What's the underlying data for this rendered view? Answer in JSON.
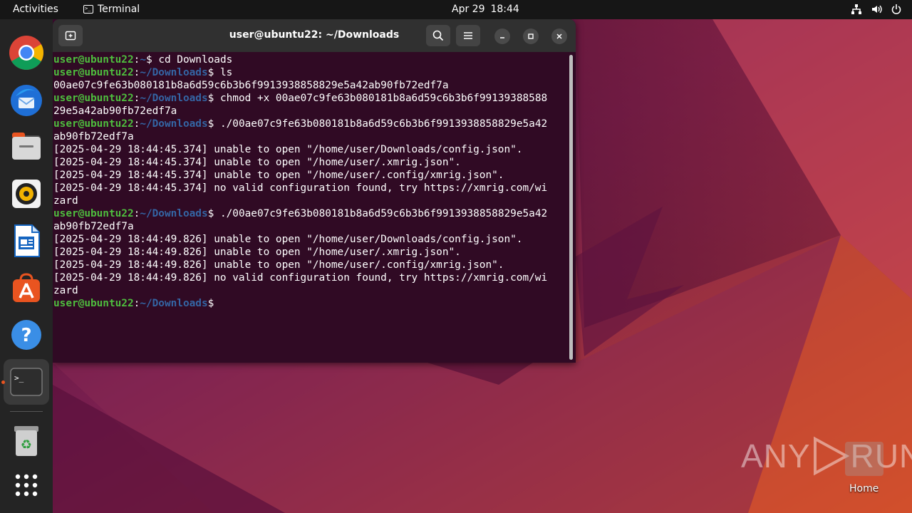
{
  "topbar": {
    "activities": "Activities",
    "app_name": "Terminal",
    "date": "Apr 29",
    "time": "18:44"
  },
  "dock": {
    "items": [
      {
        "name": "chrome-icon",
        "active": false
      },
      {
        "name": "thunderbird-icon",
        "active": false
      },
      {
        "name": "files-icon",
        "active": false
      },
      {
        "name": "rhythmbox-icon",
        "active": false
      },
      {
        "name": "writer-icon",
        "active": false
      },
      {
        "name": "app-center-icon",
        "active": false
      },
      {
        "name": "help-icon",
        "active": false
      },
      {
        "name": "terminal-icon",
        "active": true
      },
      {
        "name": "trash-icon",
        "active": false
      },
      {
        "name": "show-apps-icon",
        "active": false
      }
    ]
  },
  "window": {
    "title": "user@ubuntu22: ~/Downloads"
  },
  "terminal": {
    "user_host": "user@ubuntu22",
    "lines": [
      {
        "type": "prompt",
        "path": "~",
        "cmd": " cd Downloads"
      },
      {
        "type": "prompt",
        "path": "~/Downloads",
        "cmd": " ls"
      },
      {
        "type": "out",
        "text": "00ae07c9fe63b080181b8a6d59c6b3b6f9913938858829e5a42ab90fb72edf7a"
      },
      {
        "type": "prompt",
        "path": "~/Downloads",
        "cmd": " chmod +x 00ae07c9fe63b080181b8a6d59c6b3b6f99139388588"
      },
      {
        "type": "out",
        "text": "29e5a42ab90fb72edf7a"
      },
      {
        "type": "prompt",
        "path": "~/Downloads",
        "cmd": " ./00ae07c9fe63b080181b8a6d59c6b3b6f9913938858829e5a42"
      },
      {
        "type": "out",
        "text": "ab90fb72edf7a"
      },
      {
        "type": "out",
        "text": "[2025-04-29 18:44:45.374] unable to open \"/home/user/Downloads/config.json\"."
      },
      {
        "type": "out",
        "text": "[2025-04-29 18:44:45.374] unable to open \"/home/user/.xmrig.json\"."
      },
      {
        "type": "out",
        "text": "[2025-04-29 18:44:45.374] unable to open \"/home/user/.config/xmrig.json\"."
      },
      {
        "type": "out",
        "text": "[2025-04-29 18:44:45.374] no valid configuration found, try https://xmrig.com/wi"
      },
      {
        "type": "out",
        "text": "zard"
      },
      {
        "type": "prompt",
        "path": "~/Downloads",
        "cmd": " ./00ae07c9fe63b080181b8a6d59c6b3b6f9913938858829e5a42"
      },
      {
        "type": "out",
        "text": "ab90fb72edf7a"
      },
      {
        "type": "out",
        "text": "[2025-04-29 18:44:49.826] unable to open \"/home/user/Downloads/config.json\"."
      },
      {
        "type": "out",
        "text": "[2025-04-29 18:44:49.826] unable to open \"/home/user/.xmrig.json\"."
      },
      {
        "type": "out",
        "text": "[2025-04-29 18:44:49.826] unable to open \"/home/user/.config/xmrig.json\"."
      },
      {
        "type": "out",
        "text": "[2025-04-29 18:44:49.826] no valid configuration found, try https://xmrig.com/wi"
      },
      {
        "type": "out",
        "text": "zard"
      },
      {
        "type": "prompt",
        "path": "~/Downloads",
        "cmd": ""
      }
    ]
  },
  "desktop": {
    "watermark": "ANY RUN",
    "home_label": "Home"
  },
  "colors": {
    "terminal_bg": "#300a24",
    "prompt_user": "#4ebd3e",
    "prompt_path": "#3465a4",
    "accent": "#e95420"
  }
}
